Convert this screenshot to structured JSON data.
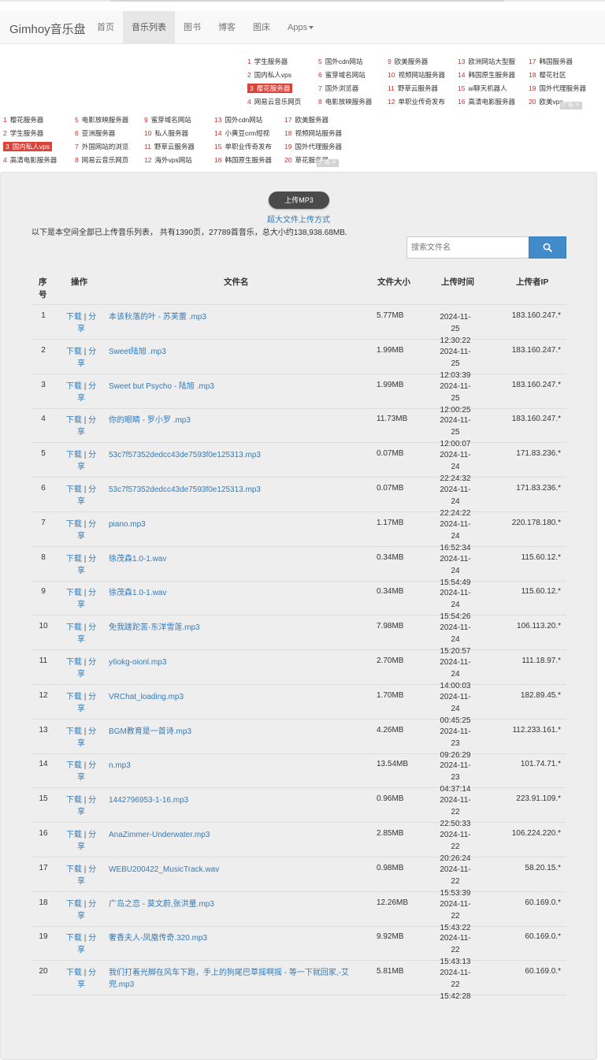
{
  "nav": {
    "brand": "Gimhoy音乐盘",
    "items": [
      {
        "label": "首页",
        "active": false
      },
      {
        "label": "音乐列表",
        "active": true
      },
      {
        "label": "图书",
        "active": false
      },
      {
        "label": "博客",
        "active": false
      },
      {
        "label": "图床",
        "active": false
      },
      {
        "label": "Apps",
        "active": false
      }
    ]
  },
  "ad_block_1": {
    "columns": [
      [
        {
          "n": "1",
          "t": "学生服务器"
        },
        {
          "n": "2",
          "t": "国内私人vps"
        },
        {
          "n": "3",
          "t": "樱花服务器",
          "hl": true
        },
        {
          "n": "4",
          "t": "网易云音乐网页"
        }
      ],
      [
        {
          "n": "5",
          "t": "国外cdn网站"
        },
        {
          "n": "6",
          "t": "蜜芽域名网站"
        },
        {
          "n": "7",
          "t": "国外浏览器"
        },
        {
          "n": "8",
          "t": "电影放映服务器"
        }
      ],
      [
        {
          "n": "9",
          "t": "欧美服务器"
        },
        {
          "n": "10",
          "t": "视频网站服务器"
        },
        {
          "n": "11",
          "t": "野草云服务器"
        },
        {
          "n": "12",
          "t": "单职业传奇发布"
        }
      ],
      [
        {
          "n": "13",
          "t": "欧洲网站大型服"
        },
        {
          "n": "14",
          "t": "韩国原生服务器"
        },
        {
          "n": "15",
          "t": "ai聊天机器人"
        },
        {
          "n": "16",
          "t": "高清电影服务器"
        }
      ],
      [
        {
          "n": "17",
          "t": "韩国服务器"
        },
        {
          "n": "18",
          "t": "樱花社区"
        },
        {
          "n": "19",
          "t": "国外代理服务器"
        },
        {
          "n": "20",
          "t": "欧美vps"
        }
      ]
    ],
    "tag": "广告 ✕"
  },
  "ad_block_2": {
    "columns": [
      [
        {
          "n": "1",
          "t": "樱花服务器"
        },
        {
          "n": "2",
          "t": "学生服务器"
        },
        {
          "n": "3",
          "t": "国内私人vps",
          "hl": true
        },
        {
          "n": "4",
          "t": "高清电影服务器"
        }
      ],
      [
        {
          "n": "5",
          "t": "电影放映服务器"
        },
        {
          "n": "6",
          "t": "亚洲服务器"
        },
        {
          "n": "7",
          "t": "外国网站的浏览"
        },
        {
          "n": "8",
          "t": "网易云音乐网页"
        }
      ],
      [
        {
          "n": "9",
          "t": "蜜芽域名网站"
        },
        {
          "n": "10",
          "t": "私人服务器"
        },
        {
          "n": "11",
          "t": "野草云服务器"
        },
        {
          "n": "12",
          "t": "海外vps网站"
        }
      ],
      [
        {
          "n": "13",
          "t": "国外cdn网站"
        },
        {
          "n": "14",
          "t": "小黄豆crm短视"
        },
        {
          "n": "15",
          "t": "单职业传奇发布"
        },
        {
          "n": "16",
          "t": "韩国原生服务器"
        }
      ],
      [
        {
          "n": "17",
          "t": "欧美服务器"
        },
        {
          "n": "18",
          "t": "视频网站服务器"
        },
        {
          "n": "19",
          "t": "国外代理服务器"
        },
        {
          "n": "20",
          "t": "草花服务器"
        }
      ]
    ],
    "tag": "广告 ✕"
  },
  "upload": {
    "button": "上传MP3",
    "big_file_link": "超大文件上传方式"
  },
  "summary": "以下是本空间全部已上传音乐列表， 共有1390页，27789首音乐，总大小约138,938.68MB.",
  "search": {
    "placeholder": "搜索文件名",
    "icon": "search-icon"
  },
  "table": {
    "headers": {
      "num": "序号",
      "action": "操作",
      "filename": "文件名",
      "size": "文件大小",
      "time": "上传时间",
      "ip": "上传者IP"
    },
    "action_download": "下载",
    "action_separator": "|",
    "action_share": "分享",
    "rows": [
      {
        "num": "1",
        "name": "本该秋落的叶 - 苏芙蕾 .mp3",
        "size": "5.77MB",
        "date": "2024-11-25",
        "time": "12:30:22",
        "ip": "183.160.247.*"
      },
      {
        "num": "2",
        "name": "Sweet陆旭 .mp3",
        "size": "1.99MB",
        "date": "2024-11-25",
        "time": "12:03:39",
        "ip": "183.160.247.*"
      },
      {
        "num": "3",
        "name": "Sweet but Psycho - 陆旭 .mp3",
        "size": "1.99MB",
        "date": "2024-11-25",
        "time": "12:00:25",
        "ip": "183.160.247.*"
      },
      {
        "num": "4",
        "name": "你的眼睛 - 罗小罗 .mp3",
        "size": "11.73MB",
        "date": "2024-11-25",
        "time": "12:00:07",
        "ip": "183.160.247.*"
      },
      {
        "num": "5",
        "name": "53c7f57352dedcc43de7593f0e125313.mp3",
        "size": "0.07MB",
        "date": "2024-11-24",
        "time": "22:24:32",
        "ip": "171.83.236.*"
      },
      {
        "num": "6",
        "name": "53c7f57352dedcc43de7593f0e125313.mp3",
        "size": "0.07MB",
        "date": "2024-11-24",
        "time": "22:24:22",
        "ip": "171.83.236.*"
      },
      {
        "num": "7",
        "name": "piano.mp3",
        "size": "1.17MB",
        "date": "2024-11-24",
        "time": "16:52:34",
        "ip": "220.178.180.*"
      },
      {
        "num": "8",
        "name": "徐茂森1.0-1.wav",
        "size": "0.34MB",
        "date": "2024-11-24",
        "time": "15:54:49",
        "ip": "115.60.12.*"
      },
      {
        "num": "9",
        "name": "徐茂森1.0-1.wav",
        "size": "0.34MB",
        "date": "2024-11-24",
        "time": "15:54:26",
        "ip": "115.60.12.*"
      },
      {
        "num": "10",
        "name": "免我蹉跎苦-东洋雪莲.mp3",
        "size": "7.98MB",
        "date": "2024-11-24",
        "time": "15:20:57",
        "ip": "106.113.20.*"
      },
      {
        "num": "11",
        "name": "y6okg-oionl.mp3",
        "size": "2.70MB",
        "date": "2024-11-24",
        "time": "14:00:03",
        "ip": "111.18.97.*"
      },
      {
        "num": "12",
        "name": "VRChat_loading.mp3",
        "size": "1.70MB",
        "date": "2024-11-24",
        "time": "00:45:25",
        "ip": "182.89.45.*"
      },
      {
        "num": "13",
        "name": "BGM教育是一首诗.mp3",
        "size": "4.26MB",
        "date": "2024-11-23",
        "time": "09:26:29",
        "ip": "112.233.161.*"
      },
      {
        "num": "14",
        "name": "n.mp3",
        "size": "13.54MB",
        "date": "2024-11-23",
        "time": "04:37:14",
        "ip": "101.74.71.*"
      },
      {
        "num": "15",
        "name": "1442796953-1-16.mp3",
        "size": "0.96MB",
        "date": "2024-11-22",
        "time": "22:50:33",
        "ip": "223.91.109.*"
      },
      {
        "num": "16",
        "name": "AnaZimmer-Underwater.mp3",
        "size": "2.85MB",
        "date": "2024-11-22",
        "time": "20:26:24",
        "ip": "106.224.220.*"
      },
      {
        "num": "17",
        "name": "WEBU200422_MusicTrack.wav",
        "size": "0.98MB",
        "date": "2024-11-22",
        "time": "15:53:39",
        "ip": "58.20.15.*"
      },
      {
        "num": "18",
        "name": "广岛之恋 - 莫文蔚,张洪量.mp3",
        "size": "12.26MB",
        "date": "2024-11-22",
        "time": "15:43:22",
        "ip": "60.169.0.*"
      },
      {
        "num": "19",
        "name": "奢香夫人-凤凰传奇.320.mp3",
        "size": "9.92MB",
        "date": "2024-11-22",
        "time": "15:43:13",
        "ip": "60.169.0.*"
      },
      {
        "num": "20",
        "name": "我们打着光脚在风车下跑，手上的狗尾巴草摇啊摇 - 等一下就回家,-艾兜.mp3",
        "size": "5.81MB",
        "date": "2024-11-22",
        "time": "15:42:28",
        "ip": "60.169.0.*"
      }
    ]
  }
}
